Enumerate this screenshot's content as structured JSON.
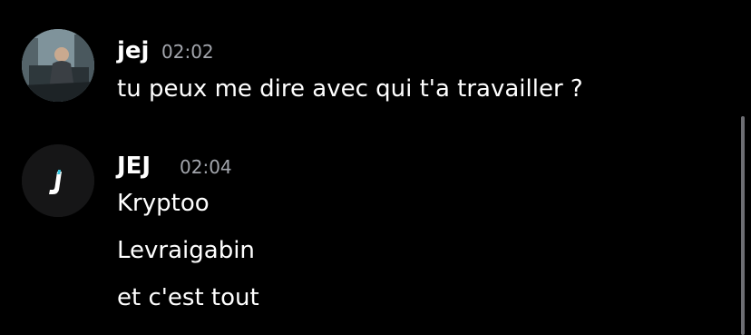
{
  "messages": [
    {
      "author": "jej",
      "time": "02:02",
      "avatar": "photo-avatar",
      "lines": [
        "tu peux me dire avec qui t'a travailler ?"
      ]
    },
    {
      "author": "JEJ",
      "time": "02:04",
      "avatar": "logo-avatar",
      "lines": [
        "Kryptoo",
        "Levraigabin",
        "et c'est tout"
      ]
    }
  ],
  "colors": {
    "background": "#000000",
    "text": "#ffffff",
    "timestamp": "#a3a6ad",
    "logo_accent": "#ffffff"
  }
}
